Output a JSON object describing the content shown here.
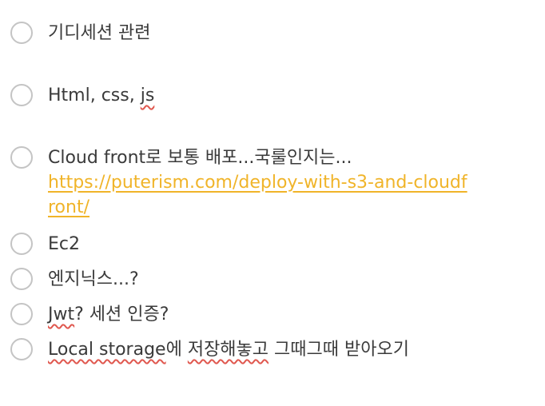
{
  "items": [
    {
      "text": "기디세션 관련"
    },
    {
      "text_before": "Html, css, ",
      "misspelled": "js"
    },
    {
      "text": "Cloud front로 보통 배포...국룰인지는...",
      "link": "https://puterism.com/deploy-with-s3-and-cloudfront/"
    },
    {
      "text": "Ec2"
    },
    {
      "text": "엔지닉스...?"
    },
    {
      "misspelled": "Jwt",
      "text_after": "? 세션 인증?"
    },
    {
      "misspelled": "Local storage",
      "text_after_mid": "에 ",
      "misspelled2": "저장해놓고",
      "text_after": " 그때그때 받아오기"
    }
  ],
  "colors": {
    "text": "#3a3a3a",
    "checkbox_border": "#c4c4c4",
    "link": "#f0b429",
    "spellcheck": "#e0584f"
  }
}
